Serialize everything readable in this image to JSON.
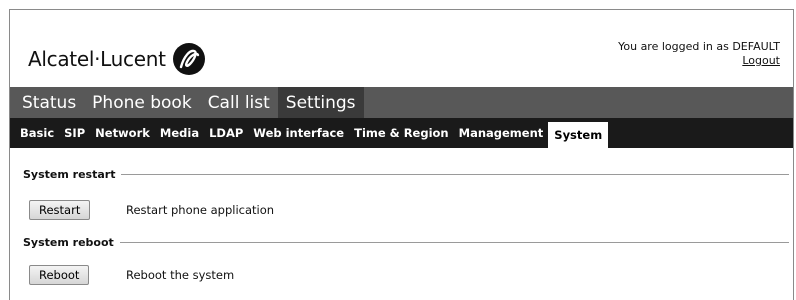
{
  "brand": {
    "name": "Alcatel·Lucent",
    "logo_icon": "alcatel-lucent-swirl"
  },
  "login": {
    "text": "You are logged in as DEFAULT",
    "logout_label": "Logout"
  },
  "main_tabs": [
    {
      "label": "Status",
      "active": false
    },
    {
      "label": "Phone book",
      "active": false
    },
    {
      "label": "Call list",
      "active": false
    },
    {
      "label": "Settings",
      "active": true
    }
  ],
  "sub_tabs": [
    {
      "label": "Basic",
      "active": false
    },
    {
      "label": "SIP",
      "active": false
    },
    {
      "label": "Network",
      "active": false
    },
    {
      "label": "Media",
      "active": false
    },
    {
      "label": "LDAP",
      "active": false
    },
    {
      "label": "Web interface",
      "active": false
    },
    {
      "label": "Time & Region",
      "active": false
    },
    {
      "label": "Management",
      "active": false
    },
    {
      "label": "System",
      "active": true
    }
  ],
  "sections": {
    "restart": {
      "title": "System restart",
      "button_label": "Restart",
      "description": "Restart phone application"
    },
    "reboot": {
      "title": "System reboot",
      "button_label": "Reboot",
      "description": "Reboot the system"
    }
  },
  "colors": {
    "main_nav_bg": "#585858",
    "main_nav_active": "#3a3a3a",
    "sub_nav_bg": "#1a1a1a"
  }
}
